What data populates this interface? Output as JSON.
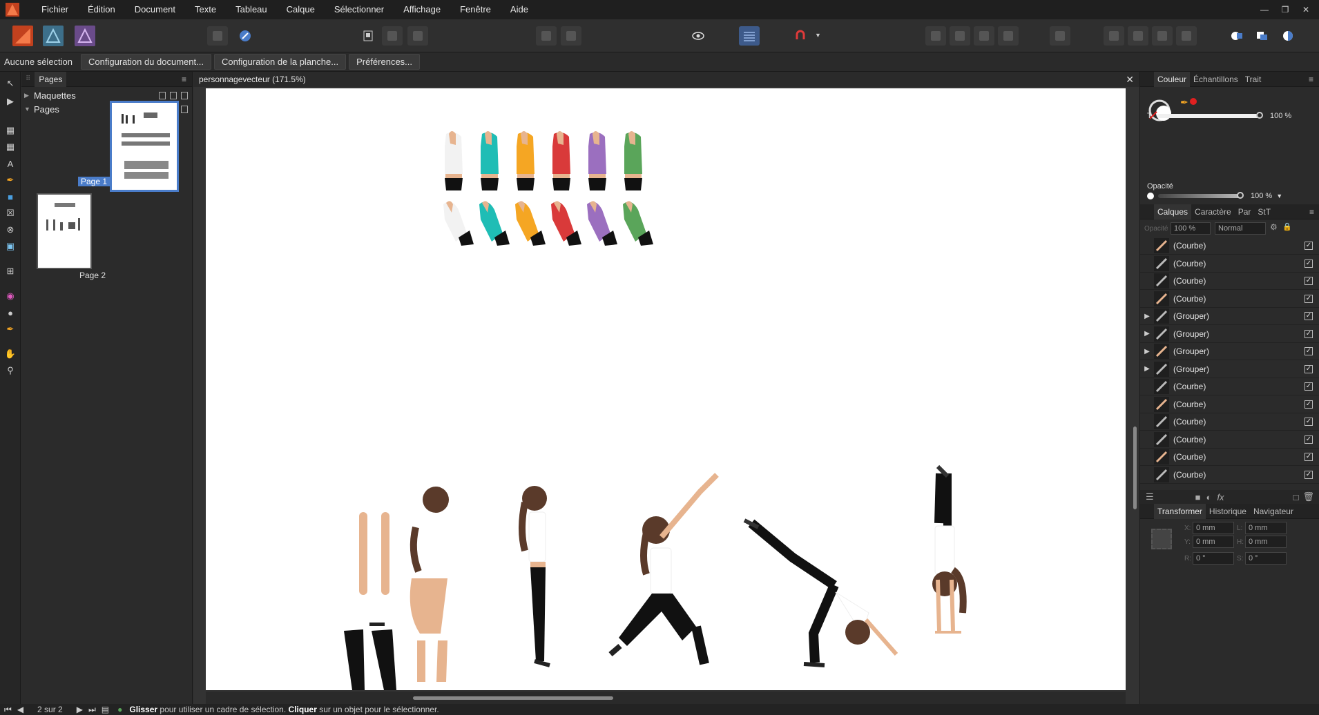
{
  "menu": [
    "Fichier",
    "Édition",
    "Document",
    "Texte",
    "Tableau",
    "Calque",
    "Sélectionner",
    "Affichage",
    "Fenêtre",
    "Aide"
  ],
  "context": {
    "selection": "Aucune sélection",
    "buttons": [
      "Configuration du document...",
      "Configuration de la planche...",
      "Préférences..."
    ]
  },
  "pages_panel": {
    "tab": "Pages",
    "masters": "Maquettes",
    "pages": "Pages",
    "page1": "Page 1",
    "page2": "Page 2"
  },
  "document": {
    "title": "personnagevecteur (171.5%)"
  },
  "color_panel": {
    "tabs": [
      "Couleur",
      "Échantillons",
      "Trait"
    ],
    "t_label": "T",
    "t_value": "100 %",
    "opacity_label": "Opacité",
    "opacity_value": "100 %",
    "accent": "#e02020",
    "tint_fraction": 1.0,
    "opacity_fraction": 1.0
  },
  "layers_panel": {
    "tabs": [
      "Calques",
      "Caractère",
      "Par",
      "StT"
    ],
    "opacity_label": "Opacité",
    "opacity_value": "100 %",
    "blend": "Normal",
    "layers": [
      {
        "name": "(Courbe)",
        "group": false
      },
      {
        "name": "(Courbe)",
        "group": false
      },
      {
        "name": "(Courbe)",
        "group": false
      },
      {
        "name": "(Courbe)",
        "group": false
      },
      {
        "name": "(Grouper)",
        "group": true
      },
      {
        "name": "(Grouper)",
        "group": true
      },
      {
        "name": "(Grouper)",
        "group": true
      },
      {
        "name": "(Grouper)",
        "group": true
      },
      {
        "name": "(Courbe)",
        "group": false
      },
      {
        "name": "(Courbe)",
        "group": false
      },
      {
        "name": "(Courbe)",
        "group": false
      },
      {
        "name": "(Courbe)",
        "group": false
      },
      {
        "name": "(Courbe)",
        "group": false
      },
      {
        "name": "(Courbe)",
        "group": false
      }
    ]
  },
  "transform_panel": {
    "tabs": [
      "Transformer",
      "Historique",
      "Navigateur"
    ],
    "x_label": "X:",
    "x": "0 mm",
    "y_label": "Y:",
    "y": "0 mm",
    "w_label": "L:",
    "w": "0 mm",
    "h_label": "H:",
    "h": "0 mm",
    "r_label": "R:",
    "r": "0 °",
    "s_label": "S:",
    "s": "0 °"
  },
  "status": {
    "page": "2 sur 2",
    "drag": "Glisser",
    "drag_rest": " pour utiliser un cadre de sélection. ",
    "click": "Cliquer",
    "click_rest": " sur un objet pour le sélectionner."
  },
  "torso_colors": [
    "#f2f2f2",
    "#1fbdb5",
    "#f5a623",
    "#d93a3a",
    "#9b6fbf",
    "#5aa55a"
  ],
  "skin": "#e7b48f",
  "hair": "#5a3a2a"
}
